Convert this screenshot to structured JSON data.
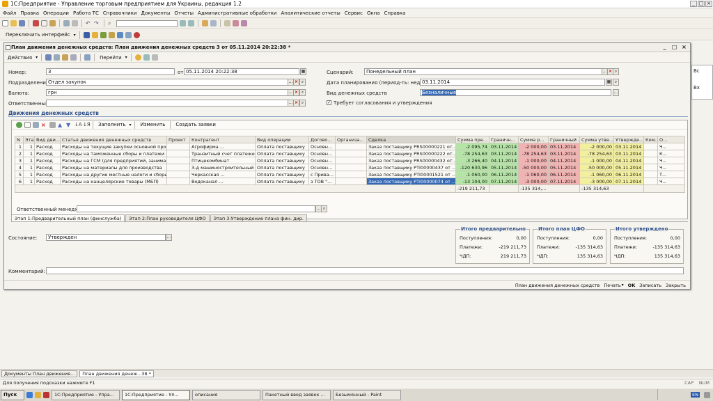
{
  "app": {
    "title": "1С:Предприятие - Управление торговым предприятием для Украины, редакция 1.2",
    "menu": [
      "Файл",
      "Правка",
      "Операции",
      "Работа ТС",
      "Справочники",
      "Документы",
      "Отчеты",
      "Административные обработки",
      "Аналитические отчеты",
      "Сервис",
      "Окна",
      "Справка"
    ],
    "switch_interface": "Переключить интерфейс"
  },
  "doc": {
    "title": "План движения денежных средств: План движения денежных средств 3 от 05.11.2014 20:22:38 *",
    "actions_label": "Действия",
    "goto_label": "Перейти",
    "fields": {
      "number_label": "Номер:",
      "number": "3",
      "from_label": "от:",
      "date": "05.11.2014 20:22:38",
      "scenario_label": "Сценарий:",
      "scenario": "Понедельный план",
      "department_label": "Подразделение:",
      "department": "Отдел закупок",
      "plan_date_label": "Дата планирования (период-ть: неделя)",
      "plan_date": "03.11.2014",
      "currency_label": "Валюта:",
      "currency": "грн",
      "money_type_label": "Вид денежных средств",
      "money_type": "Безналичные",
      "responsible_label": "Ответственный:",
      "responsible": "",
      "approval_label": "Требует согласования и утверждения"
    },
    "section_title": "Движения денежных средств",
    "table_toolbar": {
      "fill": "Заполнить",
      "change": "Изменить",
      "create": "Создать заявки"
    },
    "columns": [
      "N",
      "Эта...",
      "Вид дви...",
      "Статья движения денежных средств",
      "Проект",
      "Контрагент",
      "Вид операции",
      "Догово...",
      "Организа...",
      "Сделка",
      "Сумма пре...",
      "Граничн...",
      "Сумма р...",
      "Граничный ...",
      "Сумма утве...",
      "Утвержде...",
      "Ком...",
      "О..."
    ],
    "rows": [
      [
        "1",
        "1",
        "Расход",
        "Расходы на текущие закупки основной про...",
        "",
        "Агрофирма ...",
        "Оплата поставщику",
        "Основн...",
        "",
        "Заказ поставщику PRS00000221 от...",
        "-2 095,74",
        "03.11.2014",
        "-2 000,00",
        "03.11.2014",
        "-2 000,00",
        "03.11.2014",
        "",
        "Ч..."
      ],
      [
        "2",
        "1",
        "Расход",
        "Расходы на таможенные сборы и платежи",
        "",
        "Транзитный счет платеже...",
        "Оплата поставщику",
        "Основн...",
        "",
        "Заказ поставщику PRS00000222 от...",
        "-78 254,63",
        "03.11.2014",
        "-78 254,63",
        "03.11.2014",
        "-78 254,63",
        "03.11.2014",
        "",
        "К..."
      ],
      [
        "3",
        "1",
        "Расход",
        "Расходы на ГСМ (для предприятий, занима...",
        "",
        "Птицекомбинат",
        "Оплата поставщику",
        "Основн...",
        "",
        "Заказ поставщику PRS00000432 от...",
        "-3 266,40",
        "04.11.2014",
        "-1 000,00",
        "04.11.2014",
        "-1 000,00",
        "04.11.2014",
        "",
        "Ч..."
      ],
      [
        "4",
        "1",
        "Расход",
        "Расходы на материалы для производства",
        "",
        "З-д машиностроительный ...",
        "Оплата поставщику",
        "Основн...",
        "",
        "Заказ поставщику PTI00000437 от ...",
        "-120 630,96",
        "05.11.2014",
        "-50 000,00",
        "05.11.2014",
        "-50 000,00",
        "05.11.2014",
        "",
        "Ч..."
      ],
      [
        "5",
        "1",
        "Расход",
        "Расходы на другие местные налоги и сборы",
        "",
        "Черкасская ...",
        "Оплата поставщику",
        "с Прива...",
        "",
        "Заказ поставщику PTI00001521 от ...",
        "-1 060,00",
        "06.11.2014",
        "-1 060,00",
        "06.11.2014",
        "-1 060,00",
        "06.11.2014",
        "",
        "Т..."
      ],
      [
        "6",
        "1",
        "Расход",
        "Расходы на канцелярские товары (МБП)",
        "",
        "Водоканал ...",
        "Оплата поставщику",
        "з ТОВ \"...",
        "",
        "Заказ поставщику PTI00000074 от ...",
        "-13 104,00",
        "07.11.2014",
        "-3 000,00",
        "07.11.2014",
        "-3 000,00",
        "07.11.2014",
        "",
        "Ч..."
      ]
    ],
    "totals": {
      "plan": "-219 211,73",
      "cfo": "-135 314,...",
      "approved": "-135 314,63"
    },
    "manager_label": "Ответственный менеджер:",
    "tabs": [
      "Этап 1:Предварительный план (финслужба)",
      "Этап 2:План руководителя ЦФО",
      "Этап 3:Утверждение плана фин. дир."
    ],
    "state_label": "Состояние:",
    "state": "Утвержден",
    "comment_label": "Комментарий:",
    "summary": [
      {
        "title": "Итого предварительно",
        "income_label": "Поступления:",
        "income": "0,00",
        "payments_label": "Платежи:",
        "payments": "-219 211,73",
        "cf_label": "ЧДП:",
        "cf": "219 211,73"
      },
      {
        "title": "Итого план ЦФО",
        "income_label": "Поступления:",
        "income": "0,00",
        "payments_label": "Платежи:",
        "payments": "-135 314,63",
        "cf_label": "ЧДП:",
        "cf": "135 314,63"
      },
      {
        "title": "Итого утверждено",
        "income_label": "Поступления:",
        "income": "0,00",
        "payments_label": "Платежи:",
        "payments": "-135 314,63",
        "cf_label": "ЧДП:",
        "cf": "135 314,63"
      }
    ],
    "bottom_buttons": {
      "cashflow": "План движения денежных средств",
      "print": "Печать",
      "ok": "OK",
      "save": "Записать",
      "close": "Закрыть"
    }
  },
  "bg_side": {
    "col": "Вс",
    "row": "Вх"
  },
  "window_tabs": [
    "Документы План движения...",
    "План движения денеж...38 *"
  ],
  "hint": "Для получения подсказки нажмите F1",
  "indicators": {
    "caps": "CAP",
    "num": "NUM"
  },
  "taskbar": {
    "start": "Пуск",
    "tasks": [
      "1С:Предприятие - Упра...",
      "1С:Предприятие - Уп...",
      "описания",
      "Пакетный ввод заявок ...",
      "Безымянный - Paint"
    ],
    "lang": "EN"
  }
}
